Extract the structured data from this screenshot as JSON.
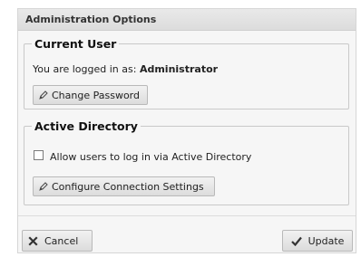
{
  "dialog": {
    "title": "Administration Options",
    "current_user": {
      "legend": "Current User",
      "logged_in_prefix": "You are logged in as: ",
      "username": "Administrator",
      "change_password_label": "Change Password"
    },
    "active_directory": {
      "legend": "Active Directory",
      "allow_login_label": "Allow users to log in via Active Directory",
      "allow_login_checked": false,
      "configure_label": "Configure Connection Settings"
    },
    "footer": {
      "cancel_label": "Cancel",
      "update_label": "Update"
    }
  },
  "icons": {
    "edit": "pencil-icon",
    "cancel": "x-icon",
    "update": "checkmark-icon"
  }
}
